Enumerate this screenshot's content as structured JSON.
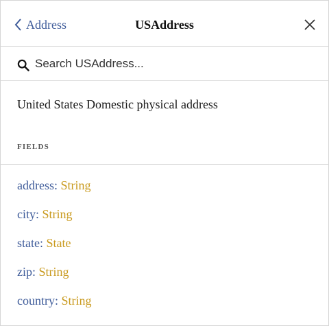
{
  "header": {
    "back_label": "Address",
    "title": "USAddress"
  },
  "search": {
    "placeholder": "Search USAddress..."
  },
  "description": "United States Domestic physical address",
  "fields_section": {
    "heading": "FIELDS",
    "fields": [
      {
        "name": "address",
        "separator": ": ",
        "type": "String"
      },
      {
        "name": "city",
        "separator": ": ",
        "type": "String"
      },
      {
        "name": "state",
        "separator": ": ",
        "type": "State"
      },
      {
        "name": "zip",
        "separator": ": ",
        "type": "String"
      },
      {
        "name": "country",
        "separator": ": ",
        "type": "String"
      }
    ]
  },
  "colors": {
    "field_name": "#3f5c9a",
    "field_type": "#c99a1e"
  }
}
